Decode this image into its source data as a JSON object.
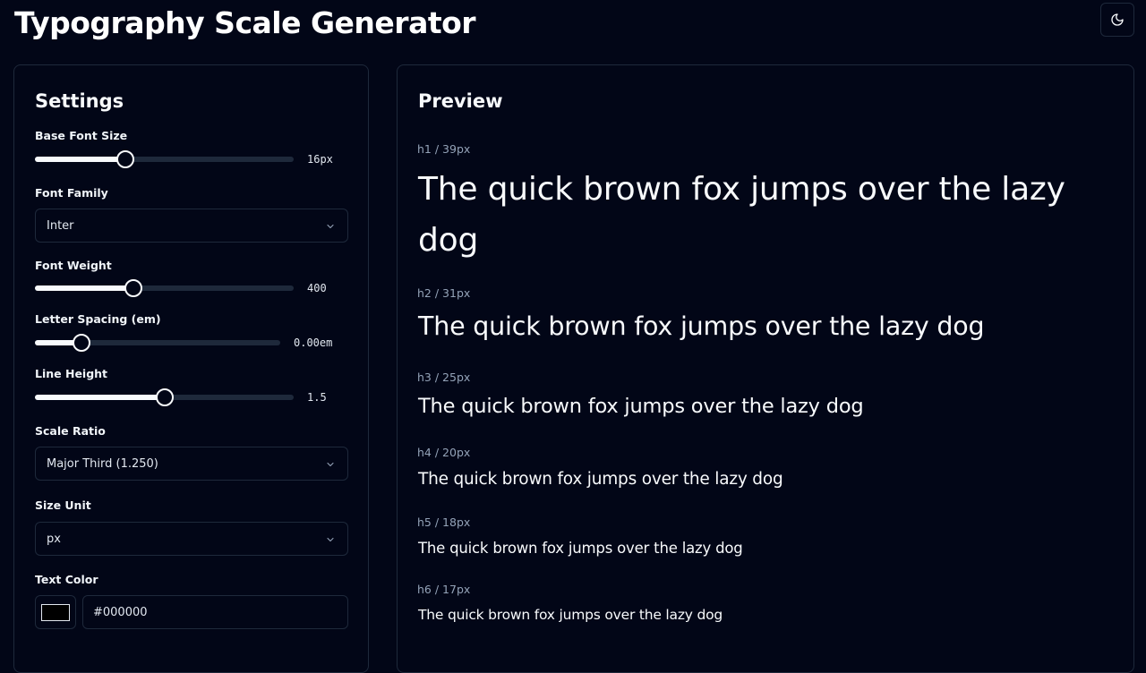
{
  "header": {
    "title": "Typography Scale Generator",
    "theme_icon": "moon-icon"
  },
  "settings": {
    "title": "Settings",
    "base_font_size": {
      "label": "Base Font Size",
      "value": "16px",
      "fraction": 0.35
    },
    "font_family": {
      "label": "Font Family",
      "selected": "Inter"
    },
    "font_weight": {
      "label": "Font Weight",
      "value": "400",
      "fraction": 0.38
    },
    "letter_spacing": {
      "label": "Letter Spacing (em)",
      "value": "0.00em",
      "fraction": 0.19
    },
    "line_height": {
      "label": "Line Height",
      "value": "1.5",
      "fraction": 0.5
    },
    "scale_ratio": {
      "label": "Scale Ratio",
      "selected": "Major Third (1.250)"
    },
    "size_unit": {
      "label": "Size Unit",
      "selected": "px"
    },
    "text_color": {
      "label": "Text Color",
      "value": "#000000",
      "swatch": "#000000"
    }
  },
  "preview": {
    "title": "Preview",
    "sample_text": "The quick brown fox jumps over the lazy dog",
    "items": [
      {
        "tag": "h1 / 39px"
      },
      {
        "tag": "h2 / 31px"
      },
      {
        "tag": "h3 / 25px"
      },
      {
        "tag": "h4 / 20px"
      },
      {
        "tag": "h5 / 18px"
      },
      {
        "tag": "h6 / 17px"
      }
    ]
  },
  "colors": {
    "background": "#020617",
    "border": "#1e293b",
    "text": "#f8fafc",
    "muted": "#94a3b8"
  }
}
